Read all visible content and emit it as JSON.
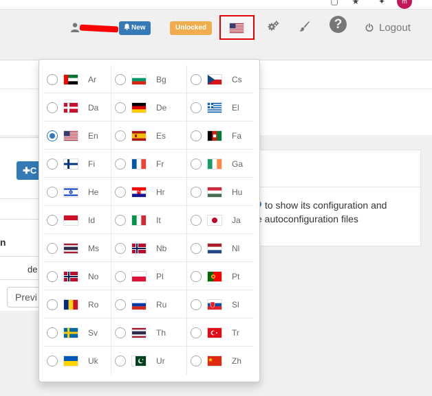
{
  "header": {
    "new_badge": "New",
    "unlocked_badge": "Unlocked",
    "logout_label": "Logout",
    "help_glyph": "?",
    "selected_flag": "us",
    "icons": [
      "user-icon",
      "bell-icon",
      "gears-icon",
      "paint-brush-icon",
      "question-circle-icon",
      "power-icon"
    ]
  },
  "browser": {
    "profile_initial": "m"
  },
  "background": {
    "create_label": "C",
    "column_header": "n",
    "cell_value": "de",
    "previous_button": "Previ",
    "info_line1": "to show its configuration and",
    "info_line2": "e autoconfiguration files"
  },
  "language_menu": {
    "selected": "En",
    "languages": [
      {
        "code": "Ar",
        "flag": "ae"
      },
      {
        "code": "Bg",
        "flag": "bg"
      },
      {
        "code": "Cs",
        "flag": "cz"
      },
      {
        "code": "Da",
        "flag": "dk"
      },
      {
        "code": "De",
        "flag": "de"
      },
      {
        "code": "El",
        "flag": "gr"
      },
      {
        "code": "En",
        "flag": "us"
      },
      {
        "code": "Es",
        "flag": "es"
      },
      {
        "code": "Fa",
        "flag": "af"
      },
      {
        "code": "Fi",
        "flag": "fi"
      },
      {
        "code": "Fr",
        "flag": "fr"
      },
      {
        "code": "Ga",
        "flag": "ie"
      },
      {
        "code": "He",
        "flag": "il"
      },
      {
        "code": "Hr",
        "flag": "hr"
      },
      {
        "code": "Hu",
        "flag": "hu"
      },
      {
        "code": "Id",
        "flag": "id"
      },
      {
        "code": "It",
        "flag": "it"
      },
      {
        "code": "Ja",
        "flag": "jp"
      },
      {
        "code": "Ms",
        "flag": "th"
      },
      {
        "code": "Nb",
        "flag": "no"
      },
      {
        "code": "Nl",
        "flag": "nl"
      },
      {
        "code": "No",
        "flag": "no"
      },
      {
        "code": "Pl",
        "flag": "pl"
      },
      {
        "code": "Pt",
        "flag": "pt"
      },
      {
        "code": "Ro",
        "flag": "ro"
      },
      {
        "code": "Ru",
        "flag": "ru"
      },
      {
        "code": "Sl",
        "flag": "sk"
      },
      {
        "code": "Sv",
        "flag": "se"
      },
      {
        "code": "Th",
        "flag": "th"
      },
      {
        "code": "Tr",
        "flag": "tr"
      },
      {
        "code": "Uk",
        "flag": "ua"
      },
      {
        "code": "Ur",
        "flag": "pk"
      },
      {
        "code": "Zh",
        "flag": "cn"
      }
    ]
  },
  "colors": {
    "primary": "#337ab7",
    "warning": "#f0ad4e",
    "highlight_border": "#e50000",
    "muted_text": "#777777"
  }
}
